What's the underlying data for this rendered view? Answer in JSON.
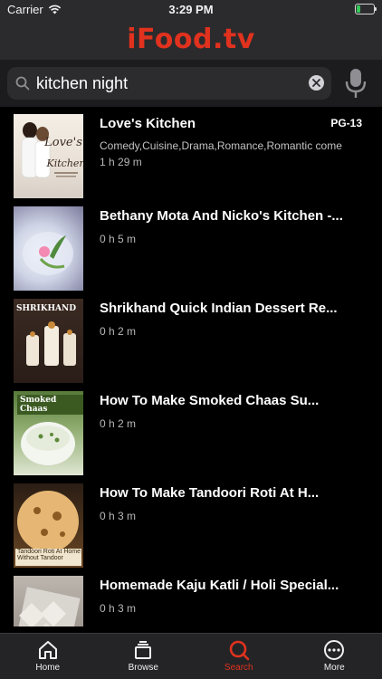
{
  "status_bar": {
    "carrier": "Carrier",
    "time": "3:29 PM"
  },
  "header": {
    "logo": "iFood.tv"
  },
  "search": {
    "query": "kitchen night"
  },
  "results": [
    {
      "title": "Love's Kitchen",
      "rating": "PG-13",
      "genres": "Comedy,Cuisine,Drama,Romance,Romantic comedy",
      "duration": "1 h 29 m",
      "thumb_label": "Love's Kitchen"
    },
    {
      "title": "Bethany Mota And Nicko's Kitchen -...",
      "duration": "0 h 5 m"
    },
    {
      "title": "Shrikhand  Quick Indian Dessert Re...",
      "duration": "0 h 2 m",
      "thumb_label": "SHRIKHAND"
    },
    {
      "title": "How To Make Smoked Chaas  Su...",
      "duration": "0 h 2 m",
      "thumb_label": "Smoked Chaas"
    },
    {
      "title": "How To Make Tandoori Roti At H...",
      "duration": "0 h 3 m",
      "thumb_label": "Tandoori Roti At Home Without Tandoor"
    },
    {
      "title": "Homemade Kaju Katli / Holi Special...",
      "duration": "0 h 3 m"
    }
  ],
  "tabs": [
    {
      "label": "Home",
      "icon": "home-icon",
      "active": false
    },
    {
      "label": "Browse",
      "icon": "browse-icon",
      "active": false
    },
    {
      "label": "Search",
      "icon": "search-icon",
      "active": true
    },
    {
      "label": "More",
      "icon": "more-icon",
      "active": false
    }
  ],
  "colors": {
    "brand": "#e0321e",
    "background": "#000000",
    "bar": "#2b2b2d"
  }
}
